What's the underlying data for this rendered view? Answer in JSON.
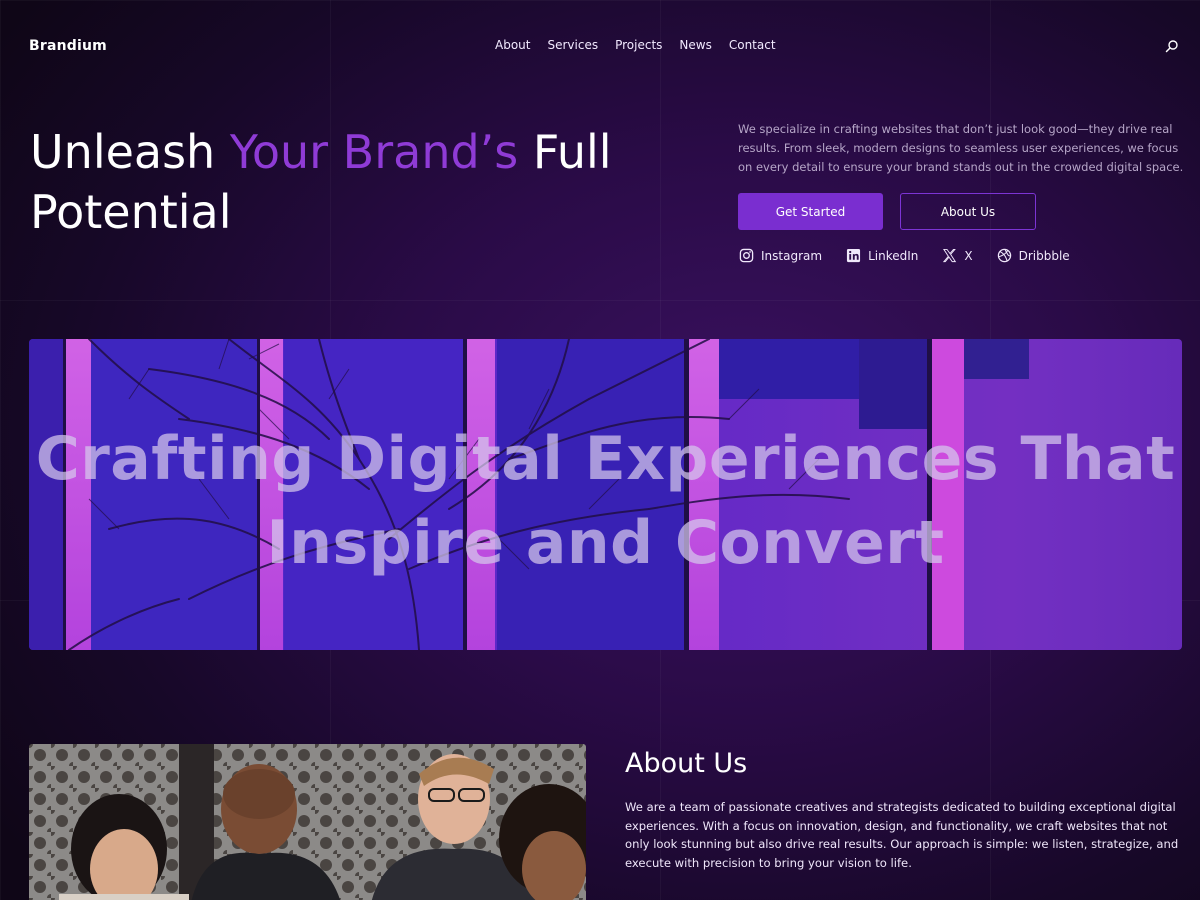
{
  "brand": {
    "logo": "Brandium"
  },
  "nav": {
    "links": [
      "About",
      "Services",
      "Projects",
      "News",
      "Contact"
    ]
  },
  "hero": {
    "title_part1": "Unleash ",
    "title_accent": "Your Brand’s",
    "title_part2": " Full Potential",
    "description": "We specialize in crafting websites that don’t just look good—they drive real results. From sleek, modern designs to seamless user experiences, we focus on every detail to ensure your brand stands out in the crowded digital space.",
    "primary_button": "Get Started",
    "secondary_button": "About Us"
  },
  "socials": [
    {
      "label": "Instagram",
      "icon": "instagram-icon"
    },
    {
      "label": "LinkedIn",
      "icon": "linkedin-icon"
    },
    {
      "label": "X",
      "icon": "x-icon"
    },
    {
      "label": "Dribbble",
      "icon": "dribbble-icon"
    }
  ],
  "banner": {
    "headline": "Crafting Digital Experiences That Inspire and Convert"
  },
  "about": {
    "title": "About Us",
    "text": "We are a team of passionate creatives and strategists dedicated to building exceptional digital experiences. With a focus on innovation, design, and functionality, we craft websites that not only look stunning but also drive real results. Our approach is simple: we listen, strategize, and execute with precision to bring your vision to life."
  },
  "colors": {
    "accent": "#8f3bd6",
    "primary_button": "#7a2ed0",
    "background": "#2a0b47"
  }
}
